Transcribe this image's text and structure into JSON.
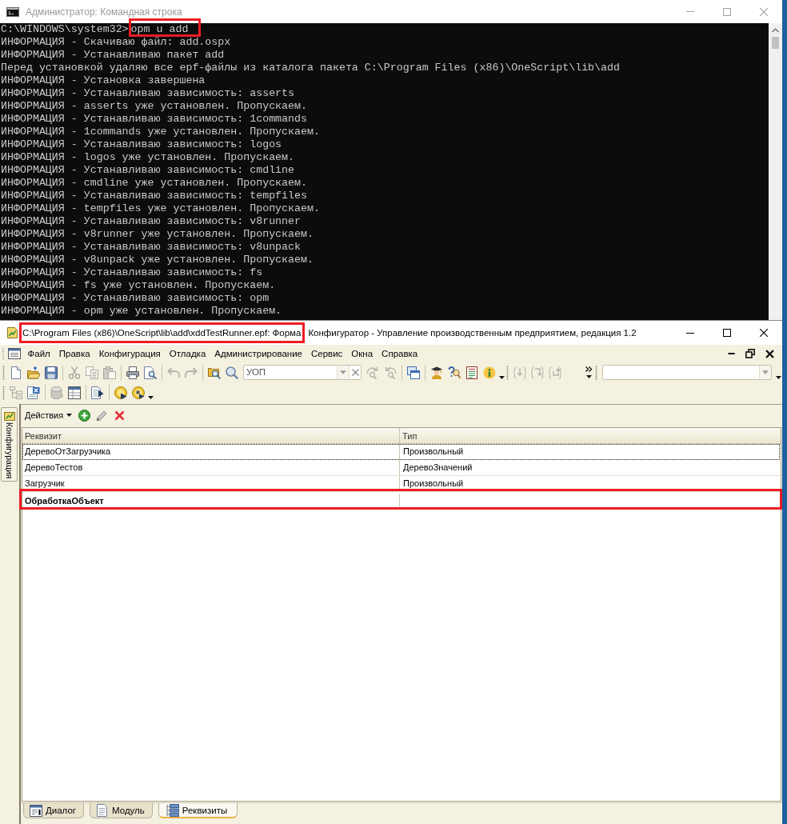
{
  "console_window": {
    "title": "Администратор: Командная строка",
    "active": false,
    "lines": [
      {
        "kind": "command",
        "prompt": "C:\\WINDOWS\\system32>",
        "command": "opm u add",
        "highlighted": true
      },
      {
        "kind": "output",
        "text": "ИНФОРМАЦИЯ - Скачиваю файл: add.ospx"
      },
      {
        "kind": "output",
        "text": "ИНФОРМАЦИЯ - Устанавливаю пакет add"
      },
      {
        "kind": "output",
        "text": "Перед установкой удаляю все epf-файлы из каталога пакета C:\\Program Files (x86)\\OneScript\\lib\\add"
      },
      {
        "kind": "output",
        "text": "ИНФОРМАЦИЯ - Установка завершена"
      },
      {
        "kind": "output",
        "text": "ИНФОРМАЦИЯ - Устанавливаю зависимость: asserts"
      },
      {
        "kind": "output",
        "text": "ИНФОРМАЦИЯ - asserts уже установлен. Пропускаем."
      },
      {
        "kind": "output",
        "text": "ИНФОРМАЦИЯ - Устанавливаю зависимость: 1commands"
      },
      {
        "kind": "output",
        "text": "ИНФОРМАЦИЯ - 1commands уже установлен. Пропускаем."
      },
      {
        "kind": "output",
        "text": "ИНФОРМАЦИЯ - Устанавливаю зависимость: logos"
      },
      {
        "kind": "output",
        "text": "ИНФОРМАЦИЯ - logos уже установлен. Пропускаем."
      },
      {
        "kind": "output",
        "text": "ИНФОРМАЦИЯ - Устанавливаю зависимость: cmdline"
      },
      {
        "kind": "output",
        "text": "ИНФОРМАЦИЯ - cmdline уже установлен. Пропускаем."
      },
      {
        "kind": "output",
        "text": "ИНФОРМАЦИЯ - Устанавливаю зависимость: tempfiles"
      },
      {
        "kind": "output",
        "text": "ИНФОРМАЦИЯ - tempfiles уже установлен. Пропускаем."
      },
      {
        "kind": "output",
        "text": "ИНФОРМАЦИЯ - Устанавливаю зависимость: v8runner"
      },
      {
        "kind": "output",
        "text": "ИНФОРМАЦИЯ - v8runner уже установлен. Пропускаем."
      },
      {
        "kind": "output",
        "text": "ИНФОРМАЦИЯ - Устанавливаю зависимость: v8unpack"
      },
      {
        "kind": "output",
        "text": "ИНФОРМАЦИЯ - v8unpack уже установлен. Пропускаем."
      },
      {
        "kind": "output",
        "text": "ИНФОРМАЦИЯ - Устанавливаю зависимость: fs"
      },
      {
        "kind": "output",
        "text": "ИНФОРМАЦИЯ - fs уже установлен. Пропускаем."
      },
      {
        "kind": "output",
        "text": "ИНФОРМАЦИЯ - Устанавливаю зависимость: opm"
      },
      {
        "kind": "output",
        "text": "ИНФОРМАЦИЯ - opm уже установлен. Пропускаем."
      }
    ]
  },
  "configurator_window": {
    "title_path": "C:\\Program Files (x86)\\OneScript\\lib\\add\\xddTestRunner.epf: Форма",
    "title_path_highlighted": true,
    "title": "Конфигуратор - Управление производственным предприятием, редакция 1.2",
    "active": true
  },
  "menu": [
    "Файл",
    "Правка",
    "Конфигурация",
    "Отладка",
    "Администрирование",
    "Сервис",
    "Окна",
    "Справка"
  ],
  "toolbars": [
    {
      "items": [
        {
          "kind": "grip"
        },
        {
          "kind": "button",
          "disabled": false
        },
        {
          "kind": "button",
          "disabled": false
        },
        {
          "kind": "button",
          "disabled": false
        },
        {
          "kind": "separator"
        },
        {
          "kind": "button",
          "disabled": true
        },
        {
          "kind": "button",
          "disabled": true
        },
        {
          "kind": "button",
          "disabled": true
        },
        {
          "kind": "separator"
        },
        {
          "kind": "button",
          "disabled": false
        },
        {
          "kind": "button",
          "disabled": false
        },
        {
          "kind": "separator"
        },
        {
          "kind": "button",
          "disabled": true
        },
        {
          "kind": "button",
          "disabled": true
        },
        {
          "kind": "separator"
        },
        {
          "kind": "button",
          "disabled": false
        },
        {
          "kind": "button",
          "disabled": false
        },
        {
          "kind": "combo",
          "value": "УОП",
          "clearable": true
        },
        {
          "kind": "button",
          "disabled": true
        },
        {
          "kind": "button",
          "disabled": true
        },
        {
          "kind": "separator"
        },
        {
          "kind": "button",
          "disabled": false
        },
        {
          "kind": "separator"
        },
        {
          "kind": "button",
          "disabled": false
        },
        {
          "kind": "button",
          "disabled": false
        },
        {
          "kind": "button",
          "disabled": false
        },
        {
          "kind": "button",
          "disabled": false
        },
        {
          "kind": "menu-caret"
        },
        {
          "kind": "grip"
        },
        {
          "kind": "button",
          "disabled": true
        },
        {
          "kind": "button",
          "disabled": true
        },
        {
          "kind": "button",
          "disabled": true
        },
        {
          "kind": "overflow"
        },
        {
          "kind": "grip"
        },
        {
          "kind": "combo",
          "clearable": false
        },
        {
          "kind": "menu-caret"
        }
      ]
    },
    {
      "items": [
        {
          "kind": "grip"
        },
        {
          "kind": "button",
          "disabled": true
        },
        {
          "kind": "button",
          "disabled": false
        },
        {
          "kind": "separator"
        },
        {
          "kind": "button",
          "disabled": true
        },
        {
          "kind": "button",
          "disabled": false
        },
        {
          "kind": "separator"
        },
        {
          "kind": "button",
          "disabled": false
        },
        {
          "kind": "separator"
        },
        {
          "kind": "button",
          "disabled": false
        },
        {
          "kind": "button",
          "disabled": false
        },
        {
          "kind": "menu-caret"
        }
      ]
    }
  ],
  "side_panel": {
    "tab_label": "Конфигурация"
  },
  "form": {
    "actions_label": "Действия",
    "table": {
      "columns": [
        "Реквизит",
        "Тип"
      ],
      "rows": [
        {
          "name": "ДеревоОтЗагрузчика",
          "type": "Произвольный",
          "main": false,
          "focused": true,
          "highlighted": false
        },
        {
          "name": "ДеревоТестов",
          "type": "ДеревоЗначений",
          "main": false,
          "focused": false,
          "highlighted": false
        },
        {
          "name": "Загрузчик",
          "type": "Произвольный",
          "main": false,
          "focused": false,
          "highlighted": false
        },
        {
          "name": "ОбработкаОбъект",
          "main": true,
          "focused": false,
          "highlighted": true
        }
      ]
    }
  },
  "tabs": [
    {
      "label": "Диалог",
      "selected": false
    },
    {
      "label": "Модуль",
      "selected": false
    },
    {
      "label": "Реквизиты",
      "selected": true
    }
  ]
}
